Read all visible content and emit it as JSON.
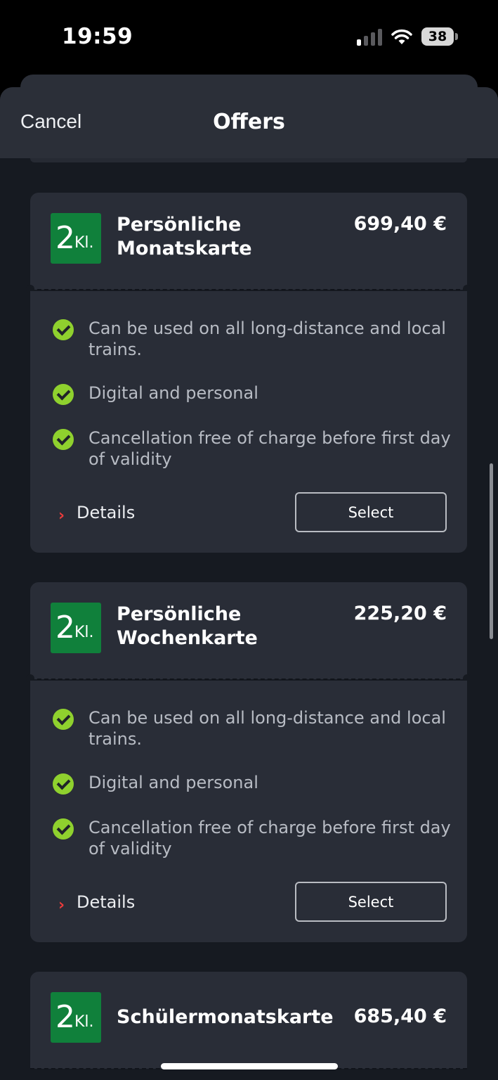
{
  "status_bar": {
    "time": "19:59",
    "battery": "38"
  },
  "nav": {
    "cancel_label": "Cancel",
    "title": "Offers"
  },
  "offers": [
    {
      "class_number": "2",
      "class_suffix": "Kl.",
      "name": "Persönliche Monatskarte",
      "price": "699,40 €",
      "features": [
        "Can be used on all long-distance and local trains.",
        "Digital and personal",
        "Cancellation free of charge before first day of validity"
      ],
      "details_label": "Details",
      "select_label": "Select"
    },
    {
      "class_number": "2",
      "class_suffix": "Kl.",
      "name": "Persönliche Wochenkarte",
      "price": "225,20 €",
      "features": [
        "Can be used on all long-distance and local trains.",
        "Digital and personal",
        "Cancellation free of charge before first day of validity"
      ],
      "details_label": "Details",
      "select_label": "Select"
    },
    {
      "class_number": "2",
      "class_suffix": "Kl.",
      "name": "Schülermonatskarte",
      "price": "685,40 €"
    }
  ],
  "icons": {
    "check": "check-circle-icon",
    "details": "chevron-right-icon",
    "signal": "cellular-signal-icon",
    "wifi": "wifi-icon",
    "battery": "battery-icon"
  },
  "colors": {
    "background": "#161a21",
    "card": "#292d37",
    "class_badge": "#10803b",
    "check": "#8fd12e",
    "chevron": "#ec3b3b"
  }
}
